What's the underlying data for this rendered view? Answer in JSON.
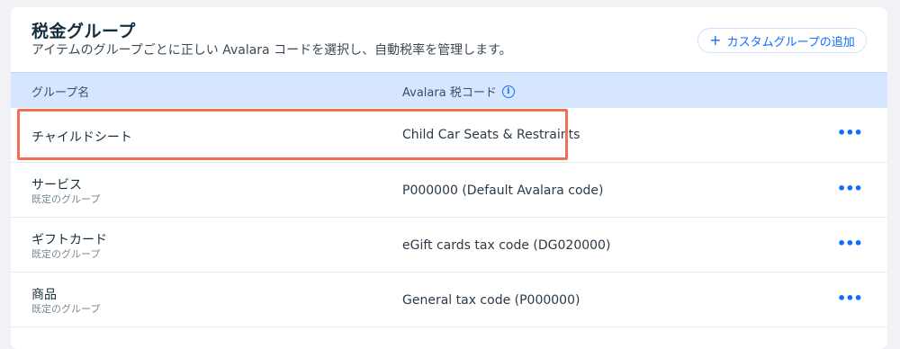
{
  "page": {
    "title": "税金グループ",
    "subtitle": "アイテムのグループごとに正しい Avalara コードを選択し、自動税率を管理します。",
    "add_button_label": "カスタムグループの追加",
    "add_button_icon": "plus-icon"
  },
  "table": {
    "columns": {
      "group_name": "グループ名",
      "tax_code": "Avalara 税コード",
      "tax_code_info_icon": "info-icon"
    },
    "rows": [
      {
        "name": "チャイルドシート",
        "sub": "",
        "code": "Child Car Seats & Restraints",
        "highlighted": true
      },
      {
        "name": "サービス",
        "sub": "既定のグループ",
        "code": "P000000 (Default Avalara code)"
      },
      {
        "name": "ギフトカード",
        "sub": "既定のグループ",
        "code": "eGift cards tax code (DG020000)"
      },
      {
        "name": "商品",
        "sub": "既定のグループ",
        "code": "General tax code (P000000)"
      }
    ],
    "row_action_icon": "more-horizontal-icon"
  },
  "colors": {
    "accent": "#116dff",
    "header_bg": "#d6e6fe",
    "highlight_border": "#ef6f55"
  }
}
